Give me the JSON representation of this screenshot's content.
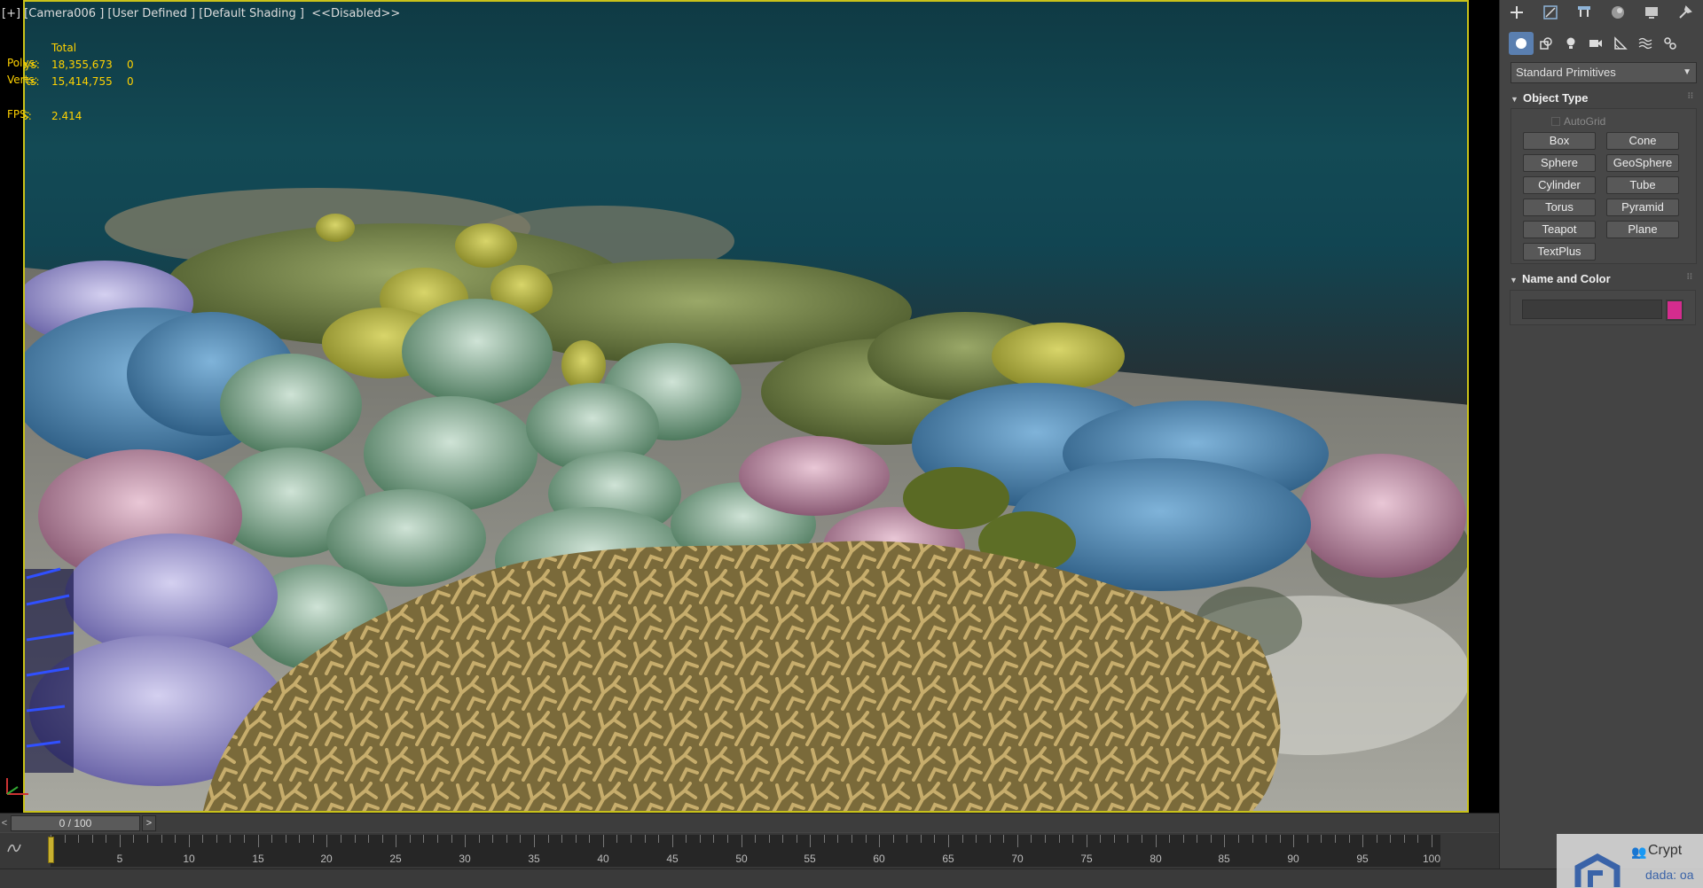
{
  "viewport": {
    "label": "[+] [Camera006 ] [User Defined ] [Default Shading ]  <<Disabled>>",
    "stats": {
      "total_label": "Total",
      "polys_label": "Polys:",
      "polys_value": "18,355,673",
      "polys_sel": "0",
      "verts_label": "Verts:",
      "verts_value": "15,414,755",
      "verts_sel": "0",
      "fps_label": "FPS:",
      "fps_value": "2.414"
    },
    "colors": {
      "border": "#c9c21a",
      "water": "#134a55",
      "ground": "#8a8a84"
    }
  },
  "timeline": {
    "prev": "<",
    "slider": "0 / 100",
    "next": ">",
    "ticks": [
      "5",
      "10",
      "15",
      "20",
      "25",
      "30",
      "35",
      "40",
      "45",
      "50",
      "55",
      "60",
      "65",
      "70",
      "75",
      "80",
      "85",
      "90",
      "95",
      "100"
    ],
    "curve_icon": "curve-icon"
  },
  "command_panel": {
    "tabs": [
      "create-icon",
      "modify-icon",
      "hierarchy-icon",
      "motion-icon",
      "display-icon",
      "utilities-icon"
    ],
    "subtabs": [
      "geometry-icon",
      "shapes-icon",
      "lights-icon",
      "cameras-icon",
      "helpers-icon",
      "spacewarps-icon",
      "systems-icon"
    ],
    "category": "Standard Primitives",
    "object_type": {
      "title": "Object Type",
      "autogrid": "AutoGrid",
      "buttons": [
        "Box",
        "Cone",
        "Sphere",
        "GeoSphere",
        "Cylinder",
        "Tube",
        "Torus",
        "Pyramid",
        "Teapot",
        "Plane",
        "TextPlus"
      ]
    },
    "name_and_color": {
      "title": "Name and Color",
      "name_value": "",
      "color": "#d42c8e"
    }
  },
  "watermark": {
    "text": "Crypt",
    "sub": "dada: oa"
  }
}
